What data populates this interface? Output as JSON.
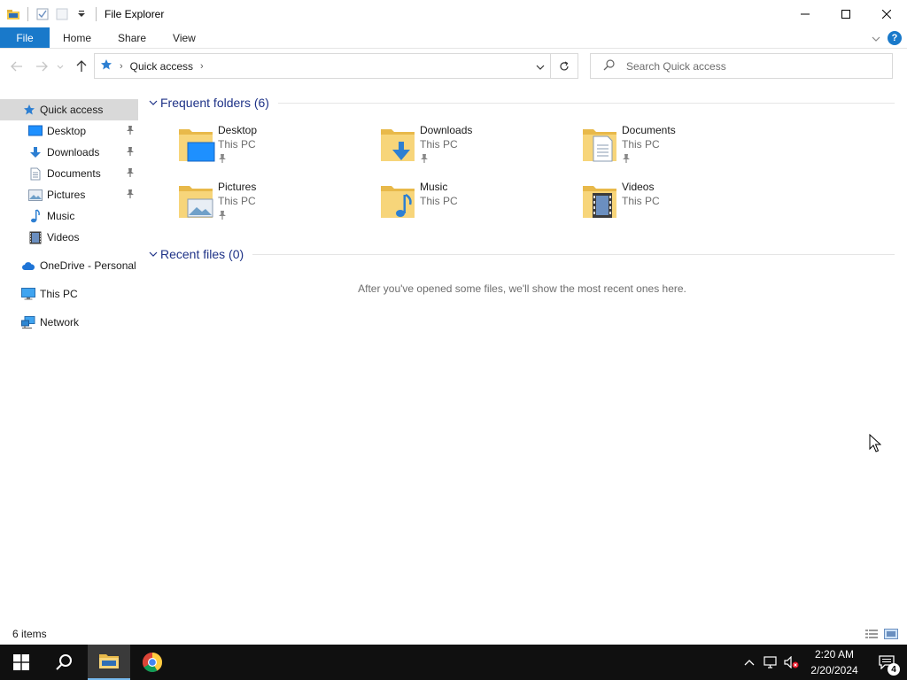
{
  "window": {
    "title": "File Explorer"
  },
  "ribbon": {
    "tabs": [
      {
        "label": "File"
      },
      {
        "label": "Home"
      },
      {
        "label": "Share"
      },
      {
        "label": "View"
      }
    ]
  },
  "address": {
    "location": "Quick access",
    "search_placeholder": "Search Quick access"
  },
  "sidebar": {
    "items": [
      {
        "label": "Quick access",
        "icon": "star-icon",
        "selected": true
      },
      {
        "label": "Desktop",
        "icon": "desktop-icon",
        "pinned": true
      },
      {
        "label": "Downloads",
        "icon": "download-icon",
        "pinned": true
      },
      {
        "label": "Documents",
        "icon": "document-icon",
        "pinned": true
      },
      {
        "label": "Pictures",
        "icon": "picture-icon",
        "pinned": true
      },
      {
        "label": "Music",
        "icon": "music-icon"
      },
      {
        "label": "Videos",
        "icon": "video-icon"
      },
      {
        "label": "OneDrive - Personal",
        "icon": "cloud-icon"
      },
      {
        "label": "This PC",
        "icon": "computer-icon"
      },
      {
        "label": "Network",
        "icon": "network-icon"
      }
    ]
  },
  "content": {
    "frequent_title": "Frequent folders (6)",
    "folders": [
      {
        "name": "Desktop",
        "location": "This PC",
        "pinned": true
      },
      {
        "name": "Downloads",
        "location": "This PC",
        "pinned": true
      },
      {
        "name": "Documents",
        "location": "This PC",
        "pinned": true
      },
      {
        "name": "Pictures",
        "location": "This PC",
        "pinned": true
      },
      {
        "name": "Music",
        "location": "This PC"
      },
      {
        "name": "Videos",
        "location": "This PC"
      }
    ],
    "recent_title": "Recent files (0)",
    "recent_empty_message": "After you've opened some files, we'll show the most recent ones here."
  },
  "status": {
    "item_count": "6 items"
  },
  "taskbar": {
    "time": "2:20 AM",
    "date": "2/20/2024",
    "notification_count": "4"
  },
  "colors": {
    "accent": "#1979ca",
    "group_title": "#1e3287",
    "taskbar": "#101010",
    "folder": "#f7d57a"
  }
}
